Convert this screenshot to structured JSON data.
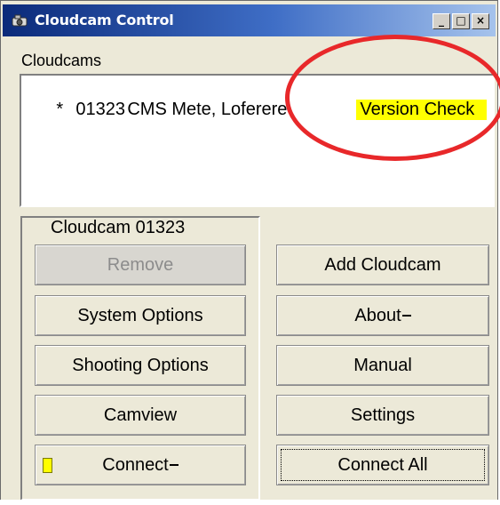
{
  "window": {
    "title": "Cloudcam Control",
    "icon": "cloudcam-app-icon",
    "controls": {
      "minimize": "_",
      "maximize": "□",
      "close": "×"
    }
  },
  "cloudcams": {
    "label": "Cloudcams",
    "rows": [
      {
        "marker": "*",
        "id": "01323",
        "name": "CMS Mete, Loferere",
        "status": "Version Check"
      }
    ]
  },
  "selected_group": {
    "title": "Cloudcam 01323",
    "buttons": [
      {
        "label": "Remove",
        "enabled": false
      },
      {
        "label": "System Options",
        "enabled": true
      },
      {
        "label": "Shooting Options",
        "enabled": true
      },
      {
        "label": "Camview",
        "enabled": true
      },
      {
        "label": "Connect",
        "enabled": true,
        "indicator_color": "#ffff00"
      }
    ]
  },
  "global_buttons": [
    {
      "label": "Add Cloudcam"
    },
    {
      "label": "About"
    },
    {
      "label": "Manual"
    },
    {
      "label": "Settings"
    },
    {
      "label": "Connect All",
      "focused": true
    }
  ],
  "colors": {
    "titlebar_start": "#0b2a7a",
    "titlebar_end": "#a6c3ec",
    "highlight": "#ffff00",
    "annotation_circle": "#e8282a",
    "window_bg": "#ece9d8"
  }
}
